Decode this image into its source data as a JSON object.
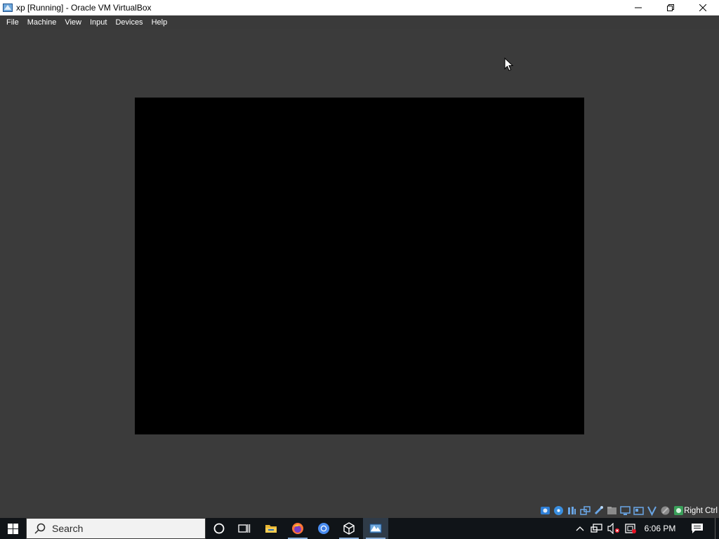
{
  "window": {
    "title": "xp [Running] - Oracle VM VirtualBox",
    "controls": [
      "minimize",
      "restore",
      "close"
    ]
  },
  "menubar": {
    "items": [
      "File",
      "Machine",
      "View",
      "Input",
      "Devices",
      "Help"
    ]
  },
  "vm": {
    "screen_state": "black"
  },
  "statusbar": {
    "icons": [
      "hard-disk-icon",
      "optical-drive-icon",
      "audio-icon",
      "network-icon",
      "usb-icon",
      "shared-folders-icon",
      "display-icon",
      "video-capture-icon",
      "graphics-icon",
      "cpu-icon",
      "mouse-integration-icon",
      "keyboard-capture-icon"
    ],
    "host_key": "Right Ctrl"
  },
  "taskbar": {
    "search_placeholder": "Search",
    "pinned": [
      "cortana-icon",
      "task-view-icon",
      "file-explorer-icon",
      "firefox-icon",
      "chrome-icon",
      "virtualbox-icon",
      "virtualbox-vm-icon"
    ],
    "tray_icons": [
      "show-hidden-icons-chevron",
      "network-icon",
      "volume-muted-icon",
      "battery-icon"
    ],
    "clock": "6:06 PM"
  },
  "colors": {
    "vm_background": "#3b3b3b",
    "taskbar": "#101418",
    "accent_underline": "#8aaed8"
  }
}
